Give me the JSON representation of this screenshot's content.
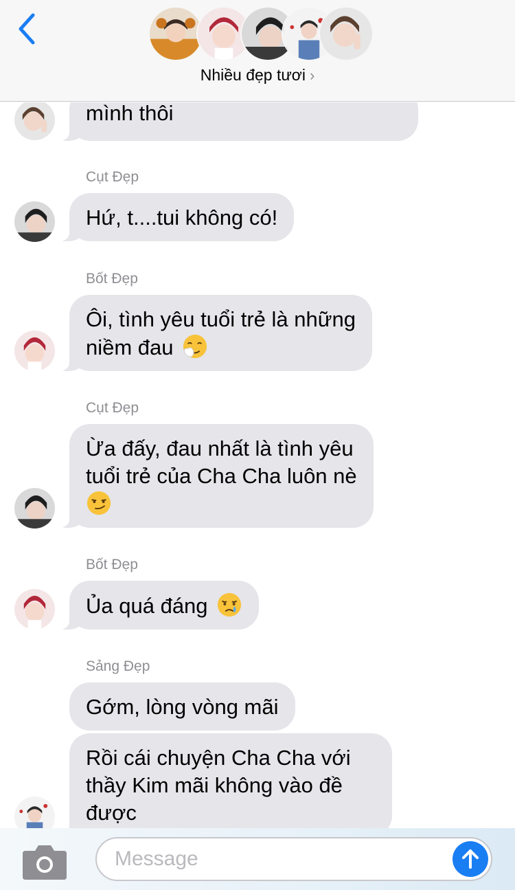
{
  "header": {
    "back_icon": "chevron-left-icon",
    "group_name": "Nhiều đẹp tươi",
    "group_chevron": "›",
    "accent_color": "#1a7ef3"
  },
  "messages": [
    {
      "sender": "",
      "lines": [
        "mình thôi"
      ],
      "emoji": ""
    },
    {
      "sender": "Cụt Đẹp",
      "lines": [
        "Hứ, t....tui không có!"
      ],
      "emoji": ""
    },
    {
      "sender": "Bốt Đẹp",
      "lines": [
        "Ôi, tình yêu tuổi trẻ là những",
        "niềm đau"
      ],
      "emoji": "sneezing-face-icon"
    },
    {
      "sender": "Cụt Đẹp",
      "lines": [
        "Ừa đấy, đau nhất là tình yêu",
        "tuổi trẻ của Cha Cha luôn nè"
      ],
      "emoji": "smirking-face-icon"
    },
    {
      "sender": "Bốt Đẹp",
      "lines": [
        "Ủa quá đáng"
      ],
      "emoji": "crying-face-icon"
    },
    {
      "sender": "Sảng Đẹp",
      "lines": [
        "Gớm, lòng vòng mãi"
      ],
      "emoji": ""
    },
    {
      "sender": "",
      "lines": [
        "Rồi cái chuyện Cha Cha với",
        "thầy Kim mãi không vào đề",
        "được"
      ],
      "emoji": ""
    }
  ],
  "input": {
    "placeholder": "Message",
    "camera_icon": "camera-icon",
    "send_icon": "send-arrow-icon"
  },
  "colors": {
    "bubble": "#e5e5ea",
    "sender_label": "#8e8e93",
    "header_bg": "#f7f7f7"
  }
}
